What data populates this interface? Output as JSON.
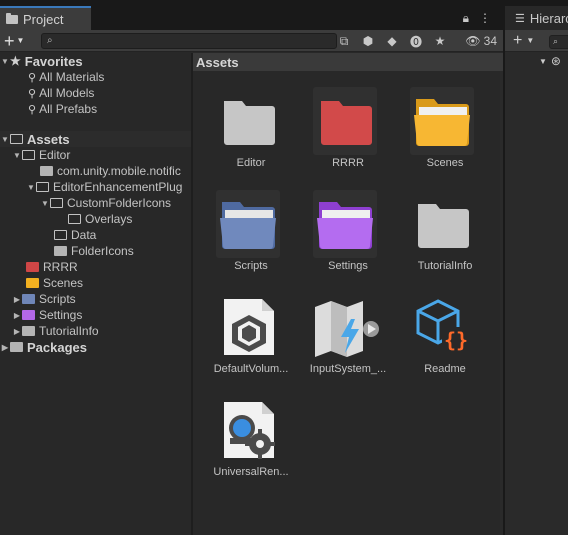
{
  "tabs": {
    "project": "Project",
    "hierarchy": "Hierarc"
  },
  "toolbar": {
    "add_label": "+",
    "search_placeholder": "",
    "count": "34"
  },
  "tree": {
    "favorites": "Favorites",
    "all_materials": "All Materials",
    "all_models": "All Models",
    "all_prefabs": "All Prefabs",
    "assets": "Assets",
    "editor": "Editor",
    "com_unity": "com.unity.mobile.notific",
    "editor_enh": "EditorEnhancementPlug",
    "custom_icons": "CustomFolderIcons",
    "overlays": "Overlays",
    "data": "Data",
    "folder_icons": "FolderIcons",
    "rrrr": "RRRR",
    "scenes": "Scenes",
    "scripts": "Scripts",
    "settings": "Settings",
    "tutorialinfo": "TutorialInfo",
    "packages": "Packages"
  },
  "grid": {
    "header": "Assets",
    "items": [
      {
        "label": "Editor"
      },
      {
        "label": "RRRR"
      },
      {
        "label": "Scenes"
      },
      {
        "label": "Scripts"
      },
      {
        "label": "Settings"
      },
      {
        "label": "TutorialInfo"
      },
      {
        "label": "DefaultVolum..."
      },
      {
        "label": "InputSystem_..."
      },
      {
        "label": "Readme"
      },
      {
        "label": "UniversalRen..."
      }
    ]
  },
  "colors": {
    "folder_gray": "#c8c8c8",
    "folder_red": "#cf4646",
    "folder_yellow": "#f2b020",
    "folder_blue": "#6f86b8",
    "folder_purple": "#b468e8",
    "accent": "#3a79bb"
  }
}
